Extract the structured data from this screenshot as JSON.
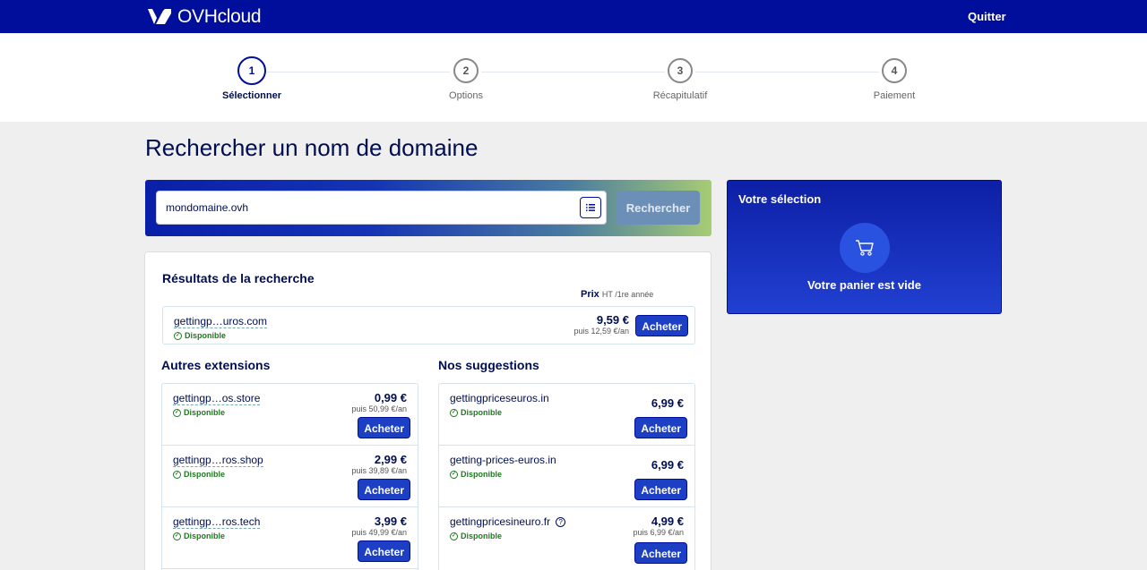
{
  "header": {
    "brand": "OVHcloud",
    "quit_label": "Quitter"
  },
  "steps": [
    {
      "number": "1",
      "label": "Sélectionner",
      "active": true
    },
    {
      "number": "2",
      "label": "Options",
      "active": false
    },
    {
      "number": "3",
      "label": "Récapitulatif",
      "active": false
    },
    {
      "number": "4",
      "label": "Paiement",
      "active": false
    }
  ],
  "page_title": "Rechercher un nom de domaine",
  "search": {
    "value": "mondomaine.ovh",
    "button_label": "Rechercher"
  },
  "results": {
    "title": "Résultats de la recherche",
    "price_header": "Prix",
    "price_header_note": "HT /1re année",
    "main": {
      "domain": "gettingp…uros.com",
      "status": "Disponible",
      "price": "9,59 €",
      "renewal": "puis 12,59 €/an",
      "buy_label": "Acheter"
    }
  },
  "other_extensions": {
    "title": "Autres extensions",
    "items": [
      {
        "domain": "gettingp…os.store",
        "status": "Disponible",
        "price": "0,99 €",
        "renewal": "puis 50,99 €/an",
        "buy_label": "Acheter"
      },
      {
        "domain": "gettingp…ros.shop",
        "status": "Disponible",
        "price": "2,99 €",
        "renewal": "puis 39,89 €/an",
        "buy_label": "Acheter"
      },
      {
        "domain": "gettingp…ros.tech",
        "status": "Disponible",
        "price": "3,99 €",
        "renewal": "puis 49,99 €/an",
        "buy_label": "Acheter"
      }
    ]
  },
  "suggestions": {
    "title": "Nos suggestions",
    "items": [
      {
        "domain": "gettingpriceseuros.in",
        "status": "Disponible",
        "price": "6,99 €",
        "renewal": "",
        "buy_label": "Acheter"
      },
      {
        "domain": "getting-prices-euros.in",
        "status": "Disponible",
        "price": "6,99 €",
        "renewal": "",
        "buy_label": "Acheter"
      },
      {
        "domain": "gettingpricesineuro.fr",
        "status": "Disponible",
        "price": "4,99 €",
        "renewal": "puis 6,99 €/an",
        "buy_label": "Acheter",
        "help_icon": "?"
      }
    ]
  },
  "cart": {
    "title": "Votre sélection",
    "empty_text": "Votre panier est vide",
    "icon": "cart-icon"
  }
}
